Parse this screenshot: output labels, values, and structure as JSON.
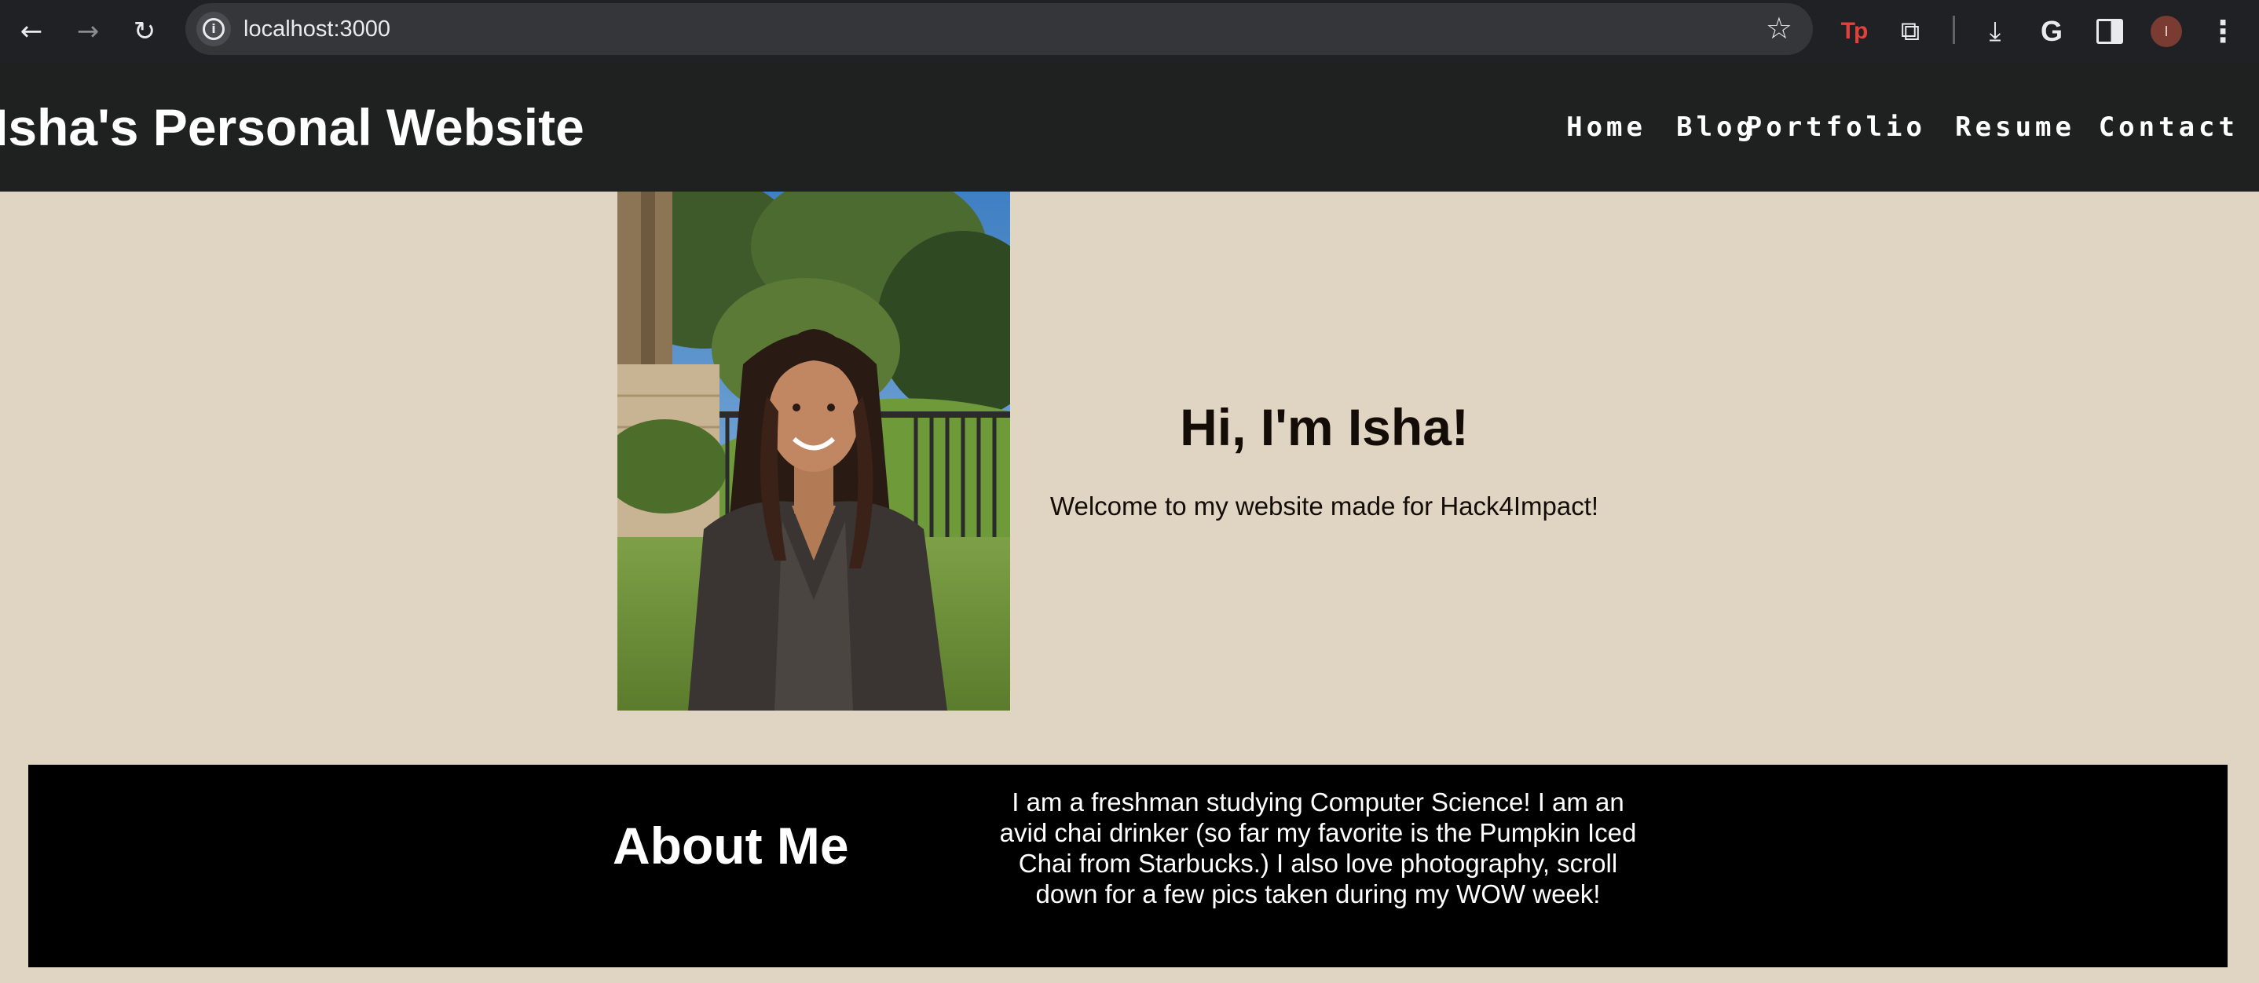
{
  "browser": {
    "url": "localhost:3000",
    "back_icon": "arrow-left-icon",
    "forward_icon": "arrow-right-icon",
    "reload_icon": "reload-icon",
    "site_info_icon": "info-icon",
    "bookmark_icon": "star-icon",
    "extensions": [
      {
        "name": "tp-extension-icon",
        "glyph": "Tp"
      },
      {
        "name": "puzzle-icon",
        "glyph": "⧉"
      },
      {
        "name": "download-icon",
        "glyph": "⤓"
      },
      {
        "name": "google-icon",
        "glyph": "G"
      },
      {
        "name": "side-panel-icon",
        "glyph": ""
      },
      {
        "name": "profile-avatar",
        "glyph": "I"
      },
      {
        "name": "kebab-menu-icon",
        "glyph": "⋮"
      }
    ]
  },
  "header": {
    "title": "Isha's Personal Website",
    "nav": [
      "Home",
      "Blog",
      "Portfolio",
      "Resume",
      "Contact"
    ]
  },
  "hero": {
    "heading": "Hi, I'm Isha!",
    "subtitle": "Welcome to my website made for Hack4Impact!"
  },
  "about": {
    "title": "About Me",
    "text": "I am a freshman studying Computer Science! I am an avid chai drinker (so far my favorite is the Pumpkin Iced Chai from Starbucks.) I also love photography, scroll down for a few pics taken during my WOW week!"
  },
  "colors": {
    "page_background": "#e0d5c3",
    "header_background": "#1f2020",
    "about_background": "#000000",
    "chrome_background": "#202124"
  }
}
